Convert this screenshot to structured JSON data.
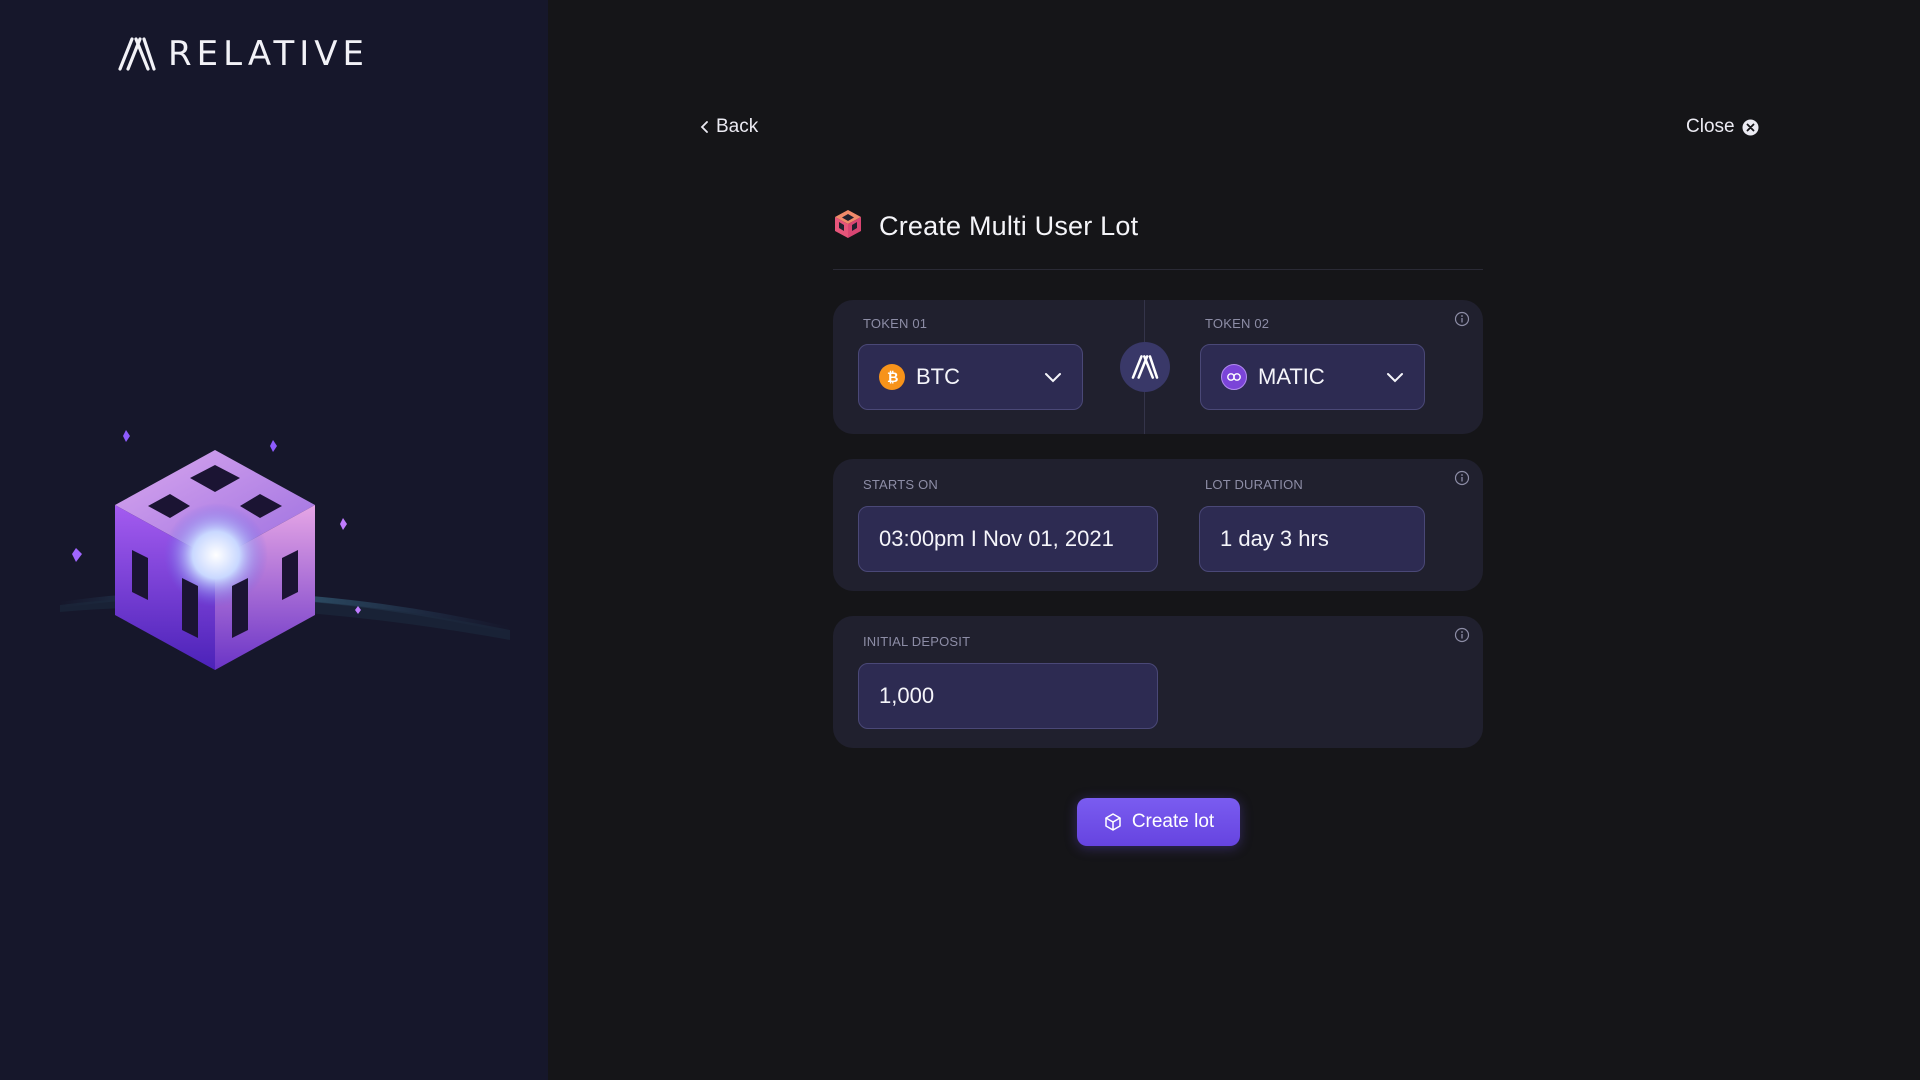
{
  "brand": {
    "name": "RELATIVE",
    "icon": "relative-logo-icon"
  },
  "nav": {
    "back_label": "Back",
    "close_label": "Close"
  },
  "form": {
    "title": "Create Multi User Lot",
    "title_icon": "cube-icon",
    "token1": {
      "label": "TOKEN 01",
      "value": "BTC",
      "icon": "bitcoin-icon"
    },
    "token2": {
      "label": "TOKEN 02",
      "value": "MATIC",
      "icon": "polygon-icon"
    },
    "starts_on": {
      "label": "STARTS ON",
      "value": "03:00pm I Nov 01, 2021"
    },
    "lot_duration": {
      "label": "LOT DURATION",
      "value": "1 day 3 hrs"
    },
    "initial_deposit": {
      "label": "INITIAL DEPOSIT",
      "value": "1,000"
    },
    "submit_label": "Create lot"
  },
  "colors": {
    "accent": "#6d4ce6",
    "panel_bg": "#16172b",
    "card_bg": "#20202e",
    "input_bg": "#2d2b52",
    "btc": "#f7931a",
    "matic": "#8247e5"
  }
}
